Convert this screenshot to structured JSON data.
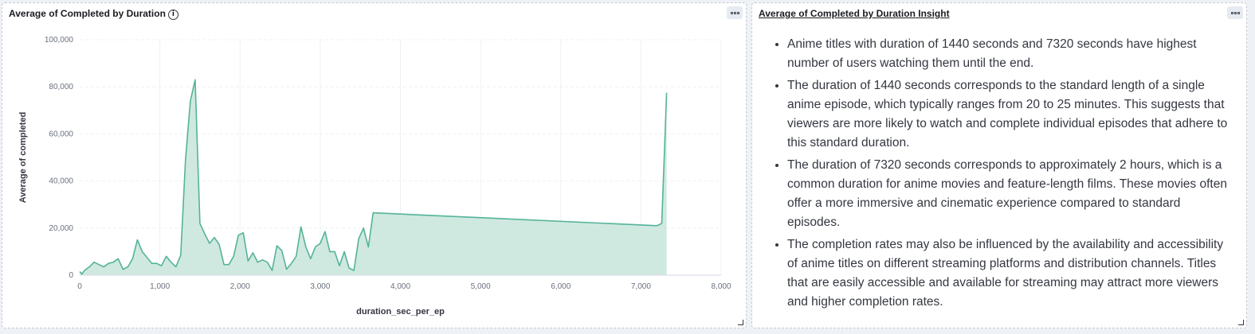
{
  "left_panel": {
    "title": "Average of Completed by Duration",
    "info_icon": "info-icon",
    "options_icon": "ellipsis-icon"
  },
  "right_panel": {
    "title": "Average of Completed by Duration Insight",
    "options_icon": "ellipsis-icon",
    "bullets": [
      "Anime titles with duration of 1440 seconds and 7320 seconds have highest number of users watching them until the end.",
      "The duration of 1440 seconds corresponds to the standard length of a single anime episode, which typically ranges from 20 to 25 minutes. This suggests that viewers are more likely to watch and complete individual episodes that adhere to this standard duration.",
      "The duration of 7320 seconds corresponds to approximately 2 hours, which is a common duration for anime movies and feature-length films. These movies often offer a more immersive and cinematic experience compared to standard episodes.",
      "The completion rates may also be influenced by the availability and accessibility of anime titles on different streaming platforms and distribution channels. Titles that are easily accessible and available for streaming may attract more viewers and higher completion rates."
    ]
  },
  "colors": {
    "line": "#54b399",
    "area": "#cfe9e0",
    "grid": "#eef0f3"
  },
  "chart_data": {
    "type": "area",
    "title": "",
    "xlabel": "duration_sec_per_ep",
    "ylabel": "Average of completed",
    "xlim": [
      0,
      8000
    ],
    "ylim": [
      0,
      100000
    ],
    "x_ticks": [
      0,
      1000,
      2000,
      3000,
      4000,
      5000,
      6000,
      7000,
      8000
    ],
    "x_tick_labels": [
      "0",
      "1,000",
      "2,000",
      "3,000",
      "4,000",
      "5,000",
      "6,000",
      "7,000",
      "8,000"
    ],
    "y_ticks": [
      0,
      20000,
      40000,
      60000,
      80000,
      100000
    ],
    "y_tick_labels": [
      "0",
      "20,000",
      "40,000",
      "60,000",
      "80,000",
      "100,000"
    ],
    "grid": true,
    "legend": false,
    "series": [
      {
        "x": [
          0,
          30,
          60,
          120,
          180,
          240,
          300,
          360,
          420,
          480,
          540,
          600,
          660,
          720,
          780,
          840,
          900,
          960,
          1020,
          1080,
          1140,
          1200,
          1260,
          1320,
          1380,
          1440,
          1500,
          1560,
          1620,
          1680,
          1740,
          1800,
          1860,
          1920,
          1980,
          2040,
          2100,
          2160,
          2220,
          2280,
          2340,
          2400,
          2460,
          2520,
          2580,
          2640,
          2700,
          2760,
          2820,
          2880,
          2940,
          3000,
          3060,
          3120,
          3180,
          3240,
          3300,
          3360,
          3420,
          3480,
          3540,
          3600,
          3660,
          7200,
          7260,
          7320
        ],
        "y": [
          1500,
          500,
          2000,
          3500,
          5500,
          4500,
          3500,
          5000,
          5500,
          7000,
          2500,
          3500,
          7000,
          15000,
          10000,
          7500,
          5000,
          5000,
          4000,
          8000,
          5500,
          3500,
          8500,
          49000,
          74000,
          83000,
          22000,
          17500,
          13500,
          16000,
          13000,
          4500,
          4500,
          8000,
          17000,
          18000,
          6000,
          9500,
          5500,
          6500,
          5500,
          2000,
          12500,
          10500,
          2500,
          5000,
          8000,
          20500,
          12000,
          7000,
          12000,
          13500,
          18500,
          10000,
          10000,
          4000,
          10000,
          3000,
          2000,
          15500,
          20000,
          12000,
          26500,
          21000,
          22000,
          77500
        ]
      }
    ]
  }
}
